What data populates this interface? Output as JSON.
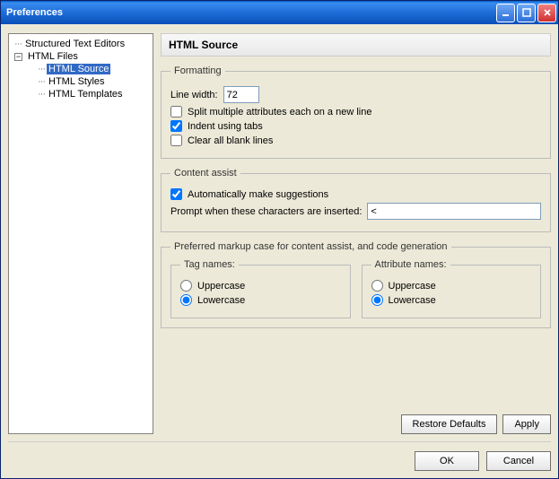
{
  "window": {
    "title": "Preferences"
  },
  "tree": {
    "item_structured": "Structured Text Editors",
    "item_html_files": "HTML Files",
    "item_html_source": "HTML Source",
    "item_html_styles": "HTML Styles",
    "item_html_templates": "HTML Templates"
  },
  "header": {
    "title": "HTML Source"
  },
  "formatting": {
    "legend": "Formatting",
    "line_width_label": "Line width:",
    "line_width_value": "72",
    "split_label": "Split multiple attributes each on a new line",
    "indent_label": "Indent using tabs",
    "clear_label": "Clear all blank lines"
  },
  "content_assist": {
    "legend": "Content assist",
    "auto_label": "Automatically make suggestions",
    "prompt_label": "Prompt when these characters are inserted:",
    "prompt_value": "<"
  },
  "markup": {
    "legend": "Preferred markup case for content assist, and code generation",
    "tag_legend": "Tag names:",
    "attr_legend": "Attribute names:",
    "uppercase": "Uppercase",
    "lowercase": "Lowercase"
  },
  "buttons": {
    "restore": "Restore Defaults",
    "apply": "Apply",
    "ok": "OK",
    "cancel": "Cancel"
  }
}
